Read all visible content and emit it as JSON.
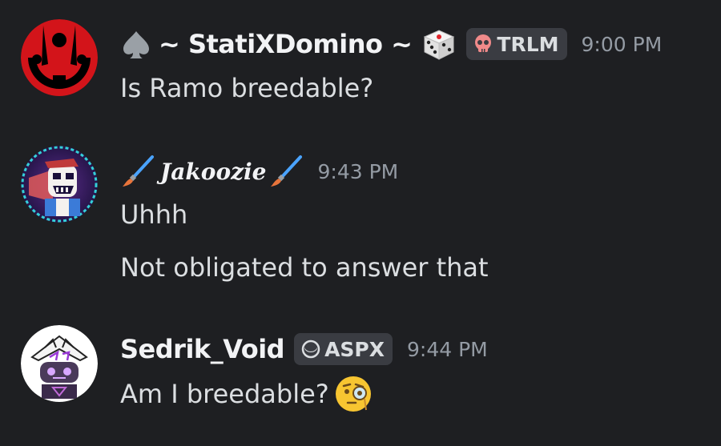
{
  "messages": [
    {
      "username": "~ StatiXDomino ~",
      "role_tag": "TRLM",
      "timestamp": "9:00 PM",
      "lines": [
        "Is Ramo breedable?"
      ]
    },
    {
      "username": "Jakoozie",
      "timestamp": "9:43 PM",
      "lines": [
        "Uhhh",
        "Not obligated to answer that"
      ]
    },
    {
      "username": "Sedrik_Void",
      "role_tag": "ASPX",
      "timestamp": "9:44 PM",
      "lines": [
        "Am I breedable?"
      ]
    }
  ],
  "icons": {
    "msg0_prefix": "spade-icon",
    "msg0_suffix": "dice-icon",
    "msg0_tag": "skull-icon",
    "msg1_prefix": "paintbrush-icon",
    "msg1_suffix": "paintbrush-icon",
    "msg2_tag": "moon-icon",
    "msg2_emoji": "face-with-monocle-emoji"
  },
  "colors": {
    "background": "#1e1f22",
    "username": "#f2f3f5",
    "text": "#dbdee1",
    "timestamp": "#949ba4",
    "tag_bg": "#3a3c42"
  }
}
